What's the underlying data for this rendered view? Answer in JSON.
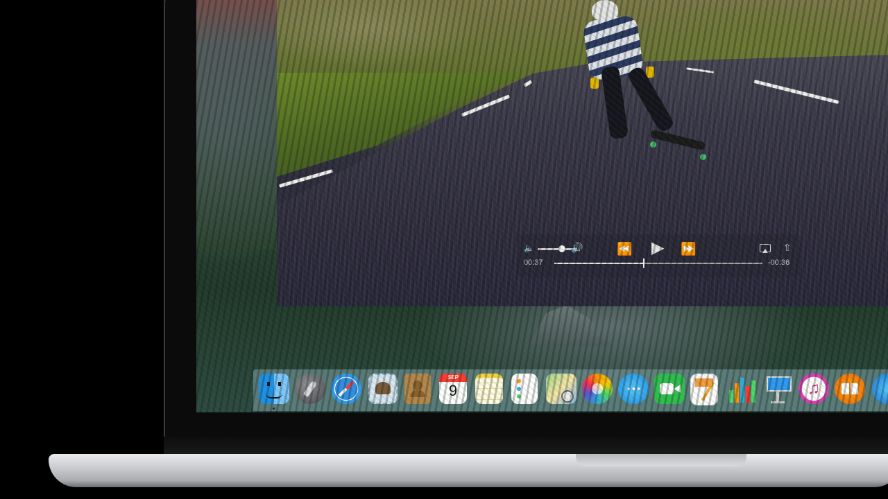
{
  "player": {
    "elapsed": "00:37",
    "remaining": "-00:36",
    "progress": 0.43,
    "volume": 0.6
  },
  "dock": {
    "calendar_month": "SEP",
    "calendar_day": "9",
    "apps": [
      "finder-icon",
      "launchpad-icon",
      "safari-icon",
      "mail-icon",
      "contacts-icon",
      "calendar-icon",
      "notes-icon",
      "reminders-icon",
      "maps-icon",
      "photos-icon",
      "messages-icon",
      "facetime-icon",
      "pages-icon",
      "numbers-icon",
      "keynote-icon",
      "itunes-icon",
      "ibooks-icon",
      "app-store-icon"
    ]
  }
}
